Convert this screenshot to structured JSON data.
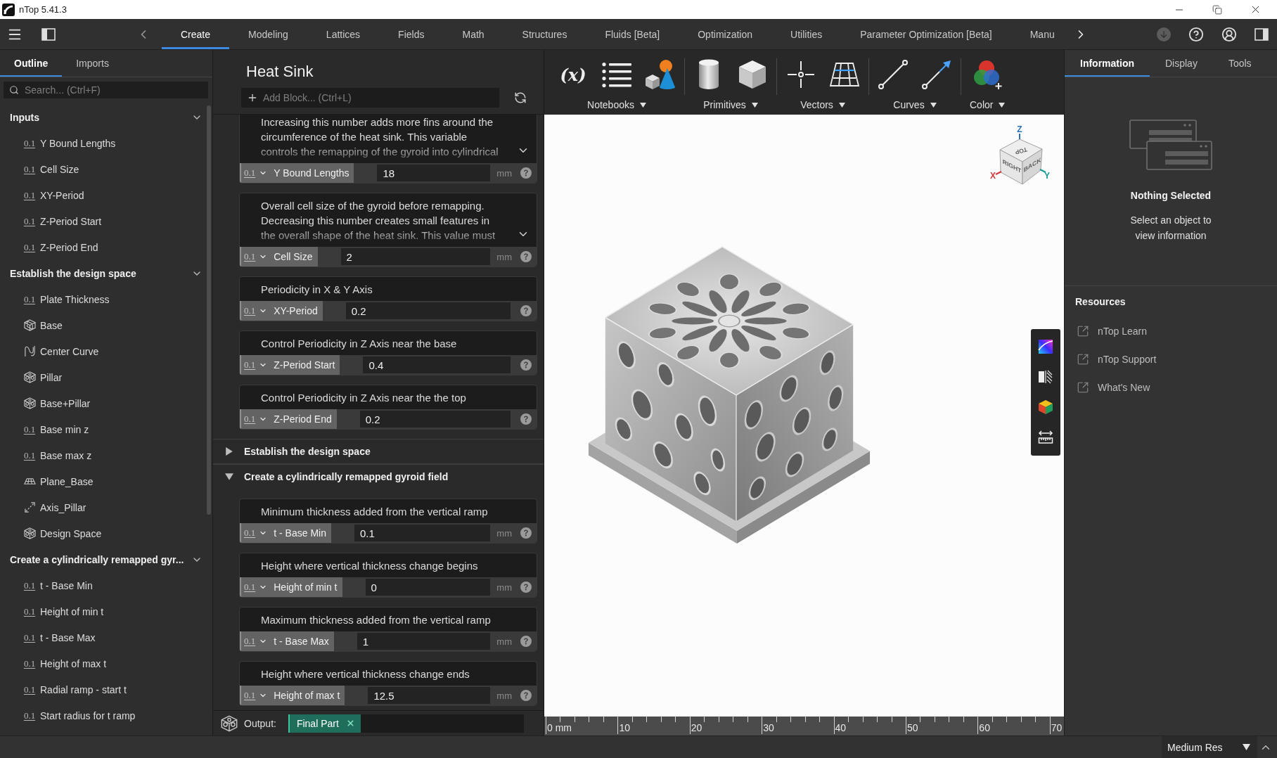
{
  "window": {
    "title": "nTop 5.41.3"
  },
  "menu_tabs": [
    {
      "label": "Create",
      "selected": true
    },
    {
      "label": "Modeling",
      "selected": false
    },
    {
      "label": "Lattices",
      "selected": false
    },
    {
      "label": "Fields",
      "selected": false
    },
    {
      "label": "Math",
      "selected": false
    },
    {
      "label": "Structures",
      "selected": false
    },
    {
      "label": "Fluids [Beta]",
      "selected": false
    },
    {
      "label": "Optimization",
      "selected": false
    },
    {
      "label": "Utilities",
      "selected": false
    },
    {
      "label": "Parameter Optimization [Beta]",
      "selected": false
    },
    {
      "label": "Manu",
      "selected": false
    }
  ],
  "outline": {
    "tabs": [
      {
        "label": "Outline",
        "selected": true
      },
      {
        "label": "Imports",
        "selected": false
      }
    ],
    "search": {
      "placeholder": "Search... (Ctrl+F)"
    },
    "sections": [
      {
        "title": "Inputs",
        "expanded": true,
        "items": [
          {
            "kind": "scalar",
            "glyph": "0.1",
            "label": "Y Bound Lengths"
          },
          {
            "kind": "scalar",
            "glyph": "0.1",
            "label": "Cell Size"
          },
          {
            "kind": "scalar",
            "glyph": "0.1",
            "label": "XY-Period"
          },
          {
            "kind": "scalar",
            "glyph": "0.1",
            "label": "Z-Period Start"
          },
          {
            "kind": "scalar",
            "glyph": "0.1",
            "label": "Z-Period End"
          }
        ]
      },
      {
        "title": "Establish the design space",
        "expanded": true,
        "items": [
          {
            "kind": "scalar",
            "glyph": "0.1",
            "label": "Plate Thickness"
          },
          {
            "kind": "box",
            "label": "Base"
          },
          {
            "kind": "curve",
            "label": "Center Curve"
          },
          {
            "kind": "body",
            "label": "Pillar"
          },
          {
            "kind": "body",
            "label": "Base+Pillar"
          },
          {
            "kind": "scalar",
            "glyph": "0.1",
            "label": "Base min z"
          },
          {
            "kind": "scalar",
            "glyph": "0.1",
            "label": "Base max z"
          },
          {
            "kind": "plane",
            "label": "Plane_Base"
          },
          {
            "kind": "axis",
            "label": "Axis_Pillar"
          },
          {
            "kind": "body",
            "label": "Design Space"
          }
        ]
      },
      {
        "title": "Create a cylindrically remapped gyr...",
        "expanded": true,
        "items": [
          {
            "kind": "scalar",
            "glyph": "0.1",
            "label": "t - Base Min"
          },
          {
            "kind": "scalar",
            "glyph": "0.1",
            "label": "Height of min t"
          },
          {
            "kind": "scalar",
            "glyph": "0.1",
            "label": "t - Base Max"
          },
          {
            "kind": "scalar",
            "glyph": "0.1",
            "label": "Height of max t"
          },
          {
            "kind": "scalar",
            "glyph": "0.1",
            "label": "Radial ramp - start t"
          },
          {
            "kind": "scalar",
            "glyph": "0.1",
            "label": "Start radius for t ramp"
          }
        ]
      }
    ]
  },
  "notebook": {
    "title": "Heat Sink",
    "add_block": {
      "placeholder": "Add Block... (Ctrl+L)"
    },
    "blocks": [
      {
        "kind": "parameter",
        "description": "Increasing this number adds more fins around the circumference of the heat sink. This variable controls the remapping of the gyroid into cylindrical",
        "expanded": false,
        "type_glyph": "0.1",
        "name": "Y Bound Lengths",
        "value": "18",
        "unit": "mm"
      },
      {
        "kind": "parameter",
        "description": "Overall cell size of the gyroid before remapping. Decreasing this number creates small features in the overall shape of the heat sink. This value must",
        "expanded": false,
        "type_glyph": "0.1",
        "name": "Cell Size",
        "value": "2",
        "unit": "mm"
      },
      {
        "kind": "parameter",
        "description": "Periodicity in X & Y Axis",
        "type_glyph": "0.1",
        "name": "XY-Period",
        "value": "0.2"
      },
      {
        "kind": "parameter",
        "description": "Control Periodicity in Z Axis near the base",
        "type_glyph": "0.1",
        "name": "Z-Period Start",
        "value": "0.4"
      },
      {
        "kind": "parameter",
        "description": "Control Periodicity in Z Axis near the the top",
        "type_glyph": "0.1",
        "name": "Z-Period End",
        "value": "0.2"
      },
      {
        "kind": "section",
        "title": "Establish the design space",
        "expanded": false
      },
      {
        "kind": "section",
        "title": "Create a cylindrically remapped gyroid field",
        "expanded": true,
        "children": [
          {
            "kind": "parameter",
            "description": "Minimum thickness added from the vertical ramp",
            "type_glyph": "0.1",
            "name": "t - Base Min",
            "value": "0.1",
            "unit": "mm"
          },
          {
            "kind": "parameter",
            "description": "Height where vertical thickness change begins",
            "type_glyph": "0.1",
            "name": "Height of min t",
            "value": "0",
            "unit": "mm"
          },
          {
            "kind": "parameter",
            "description": "Maximum thickness added from the vertical ramp",
            "type_glyph": "0.1",
            "name": "t - Base Max",
            "value": "1",
            "unit": "mm"
          },
          {
            "kind": "parameter",
            "description": "Height where vertical thickness change ends",
            "type_glyph": "0.1",
            "name": "Height of max t",
            "value": "12.5",
            "unit": "mm"
          }
        ]
      }
    ],
    "output": {
      "label": "Output:",
      "value": "Final Part"
    }
  },
  "ribbon": {
    "groups": [
      {
        "label": "Notebooks",
        "tools": [
          {
            "kind": "variable",
            "glyph": "(x)"
          },
          {
            "kind": "list"
          },
          {
            "kind": "shapes"
          }
        ]
      },
      {
        "label": "Primitives",
        "tools": [
          {
            "kind": "cylinder"
          },
          {
            "kind": "cube"
          }
        ]
      },
      {
        "label": "Vectors",
        "tools": [
          {
            "kind": "point"
          },
          {
            "kind": "plane"
          }
        ]
      },
      {
        "label": "Curves",
        "tools": [
          {
            "kind": "line"
          },
          {
            "kind": "vector"
          }
        ]
      },
      {
        "label": "Color",
        "tools": [
          {
            "kind": "color"
          }
        ]
      }
    ]
  },
  "viewport": {
    "view_cube": {
      "faces": [
        {
          "label": "TOP"
        },
        {
          "label": "RIGHT"
        },
        {
          "label": "BACK"
        }
      ],
      "axes": [
        {
          "label": "Z"
        },
        {
          "label": "X"
        },
        {
          "label": "Y"
        }
      ]
    },
    "ruler_labels": [
      "0 mm",
      "10",
      "20",
      "30",
      "40",
      "50",
      "60",
      "70"
    ]
  },
  "properties": {
    "tabs": [
      {
        "label": "Information",
        "selected": true
      },
      {
        "label": "Display",
        "selected": false
      },
      {
        "label": "Tools",
        "selected": false
      }
    ],
    "empty_state": {
      "title": "Nothing Selected",
      "message": "Select an object to view information"
    },
    "resources": {
      "title": "Resources",
      "links": [
        {
          "label": "nTop Learn"
        },
        {
          "label": "nTop Support"
        },
        {
          "label": "What's New"
        }
      ]
    }
  },
  "status_bar": {
    "resolution": "Medium Res"
  }
}
